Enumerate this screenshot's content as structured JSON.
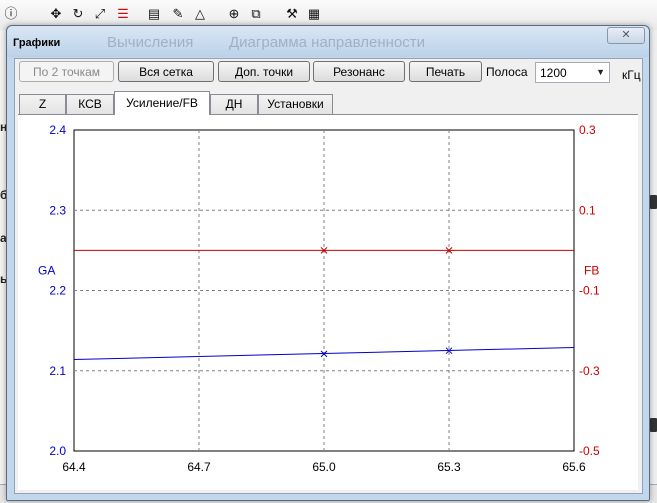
{
  "window": {
    "title": "Графики",
    "background_title_ghost": [
      "Вычисления",
      "Диаграмма направленности"
    ],
    "close_glyph": "✕"
  },
  "toolbar": {
    "buttons": [
      {
        "label": "По 2 точкам",
        "enabled": false
      },
      {
        "label": "Вся сетка",
        "enabled": true
      },
      {
        "label": "Доп. точки",
        "enabled": true
      },
      {
        "label": "Резонанс",
        "enabled": true
      },
      {
        "label": "Печать",
        "enabled": true
      }
    ],
    "band_label": "Полоса",
    "band_value": "1200",
    "band_unit": "кГц"
  },
  "tabs": [
    {
      "label": "Z",
      "active": false
    },
    {
      "label": "КСВ",
      "active": false
    },
    {
      "label": "Усиление/FB",
      "active": true
    },
    {
      "label": "ДН",
      "active": false
    },
    {
      "label": "Установки",
      "active": false
    }
  ],
  "background_app": {
    "toolbar_icons": [
      "move-icon",
      "rotate-icon",
      "resize-icon",
      "align-icon",
      "page-icon",
      "pen-icon",
      "triangle-icon",
      "target-icon",
      "copy-icon",
      "tools-icon",
      "calculator-icon"
    ],
    "left_glyphs": [
      "на",
      "б",
      "ал",
      "ь"
    ]
  },
  "chart_data": {
    "type": "line",
    "x": [
      64.4,
      64.7,
      65.0,
      65.3,
      65.6
    ],
    "xlim": [
      64.4,
      65.6
    ],
    "x_ticks": [
      "64.4",
      "64.7",
      "65.0",
      "65.3",
      "65.6"
    ],
    "ylabel": "GA",
    "ylim": [
      2.0,
      2.4
    ],
    "y_ticks": [
      "2.0",
      "2.1",
      "2.2",
      "2.3",
      "2.4"
    ],
    "y2label": "FB",
    "y2lim": [
      -0.5,
      0.3
    ],
    "y2_ticks": [
      "-0.5",
      "-0.3",
      "-0.1",
      "0.1",
      "0.3"
    ],
    "grid": true,
    "series": [
      {
        "name": "GA",
        "axis": "left",
        "color": "#0000cc",
        "x": [
          64.4,
          65.6
        ],
        "values": [
          2.114,
          2.129
        ],
        "markers": [
          {
            "x": 65.0,
            "y": 2.121
          },
          {
            "x": 65.3,
            "y": 2.125
          }
        ]
      },
      {
        "name": "FB",
        "axis": "right",
        "color": "#cc0000",
        "x": [
          64.4,
          65.6
        ],
        "values": [
          0.0,
          0.0
        ],
        "markers": [
          {
            "x": 65.0,
            "y": 0.0
          },
          {
            "x": 65.3,
            "y": 0.0
          }
        ]
      }
    ]
  }
}
